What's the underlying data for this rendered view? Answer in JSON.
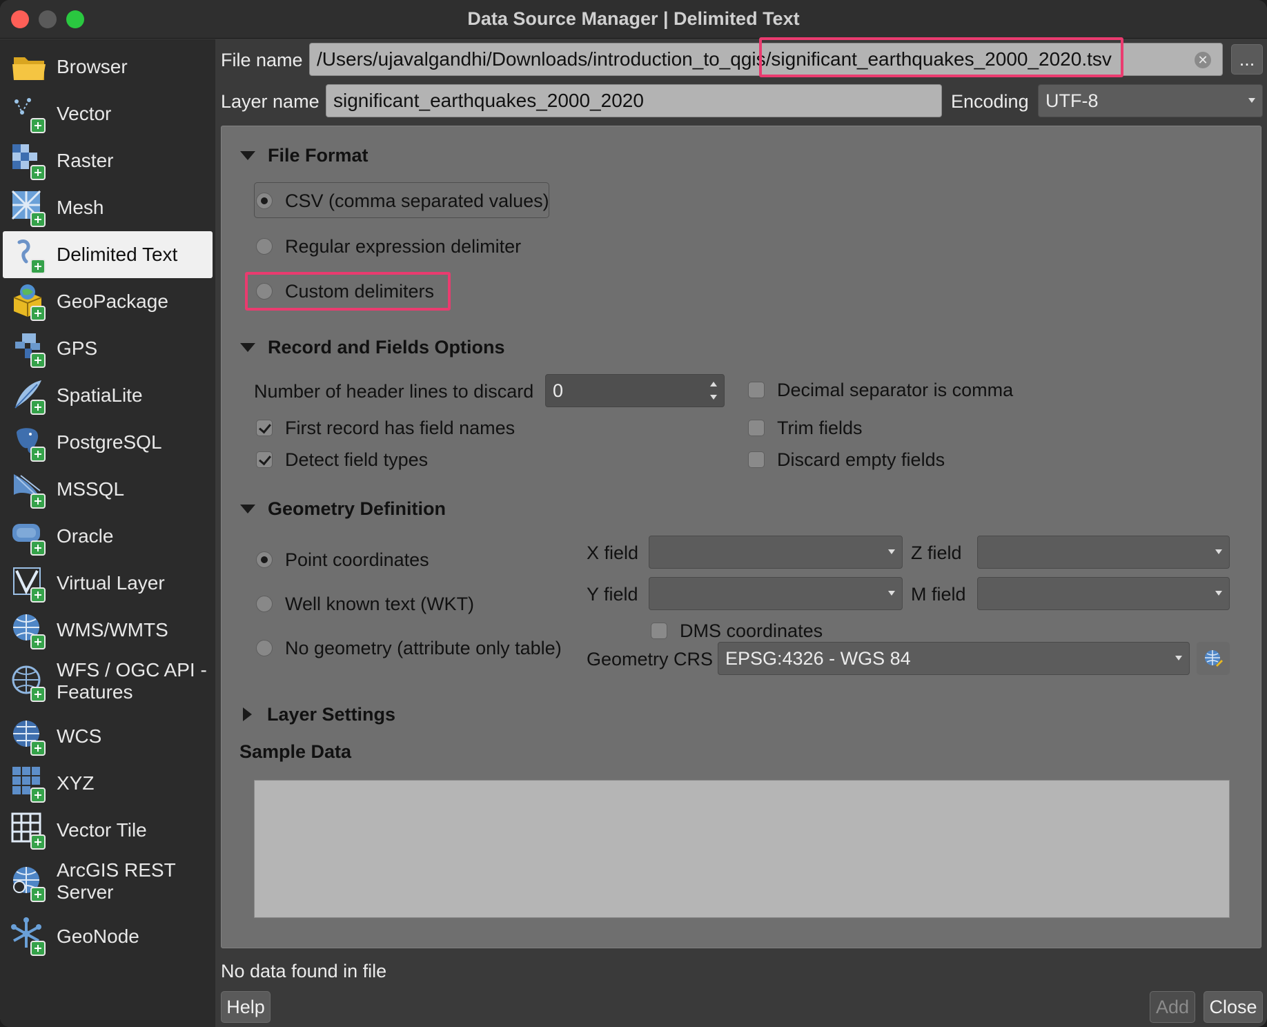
{
  "window": {
    "title": "Data Source Manager | Delimited Text"
  },
  "sidebar": {
    "items": [
      {
        "label": "Browser",
        "icon": "folder-icon"
      },
      {
        "label": "Vector",
        "icon": "vector-icon"
      },
      {
        "label": "Raster",
        "icon": "raster-icon"
      },
      {
        "label": "Mesh",
        "icon": "mesh-icon"
      },
      {
        "label": "Delimited Text",
        "icon": "delimited-text-icon",
        "active": true
      },
      {
        "label": "GeoPackage",
        "icon": "geopackage-icon"
      },
      {
        "label": "GPS",
        "icon": "gps-icon"
      },
      {
        "label": "SpatiaLite",
        "icon": "spatialite-icon"
      },
      {
        "label": "PostgreSQL",
        "icon": "postgresql-icon"
      },
      {
        "label": "MSSQL",
        "icon": "mssql-icon"
      },
      {
        "label": "Oracle",
        "icon": "oracle-icon"
      },
      {
        "label": "Virtual Layer",
        "icon": "virtual-layer-icon"
      },
      {
        "label": "WMS/WMTS",
        "icon": "wms-icon"
      },
      {
        "label_line1": "WFS / OGC API -",
        "label_line2": "Features",
        "icon": "wfs-icon"
      },
      {
        "label": "WCS",
        "icon": "wcs-icon"
      },
      {
        "label": "XYZ",
        "icon": "xyz-icon"
      },
      {
        "label": "Vector Tile",
        "icon": "vector-tile-icon"
      },
      {
        "label_line1": "ArcGIS REST",
        "label_line2": "Server",
        "icon": "arcgis-icon"
      },
      {
        "label": "GeoNode",
        "icon": "geonode-icon"
      }
    ]
  },
  "file": {
    "label": "File name",
    "value_prefix": "/Users/ujavalgandhi/Downloads/introduction_to_qgis",
    "value_suffix": "/significant_earthquakes_2000_2020.tsv",
    "browse_label": "..."
  },
  "layer": {
    "label": "Layer name",
    "value": "significant_earthquakes_2000_2020",
    "encoding_label": "Encoding",
    "encoding_value": "UTF-8"
  },
  "file_format": {
    "title": "File Format",
    "options": [
      "CSV (comma separated values)",
      "Regular expression delimiter",
      "Custom delimiters"
    ],
    "selected": 0
  },
  "record": {
    "title": "Record and Fields Options",
    "header_lines_label": "Number of header lines to discard",
    "header_lines_value": "0",
    "decimal_comma": "Decimal separator is comma",
    "first_record": "First record has field names",
    "trim_fields": "Trim fields",
    "detect_types": "Detect field types",
    "discard_empty": "Discard empty fields"
  },
  "geometry": {
    "title": "Geometry Definition",
    "options": [
      "Point coordinates",
      "Well known text (WKT)",
      "No geometry (attribute only table)"
    ],
    "x_label": "X field",
    "y_label": "Y field",
    "z_label": "Z field",
    "m_label": "M field",
    "dms_label": "DMS coordinates",
    "crs_label": "Geometry CRS",
    "crs_value": "EPSG:4326 - WGS 84"
  },
  "layer_settings": {
    "title": "Layer Settings"
  },
  "sample": {
    "title": "Sample Data"
  },
  "status": {
    "text": "No data found in file"
  },
  "buttons": {
    "help": "Help",
    "add": "Add",
    "close": "Close"
  },
  "colors": {
    "highlight": "#ea3b6f",
    "active_item": "#f0f0f0"
  }
}
